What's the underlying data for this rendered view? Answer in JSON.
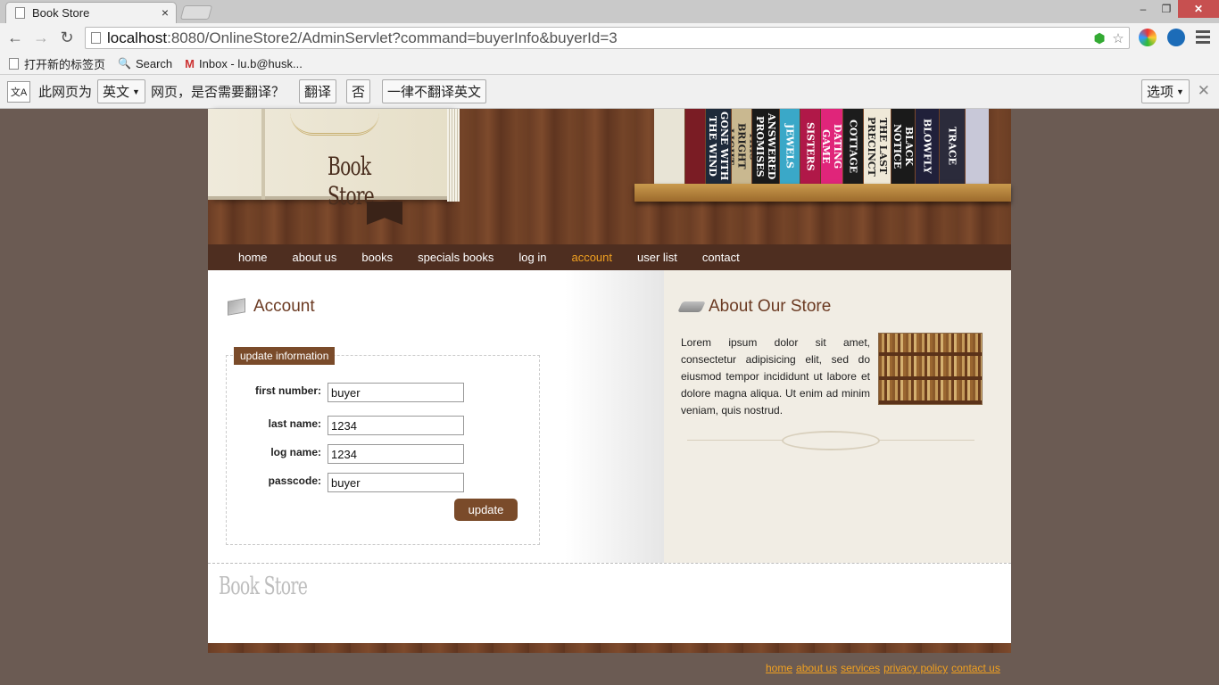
{
  "browser": {
    "tab_title": "Book Store",
    "tab_close": "×",
    "url_host": "localhost",
    "url_rest": ":8080/OnlineStore2/AdminServlet?command=buyerInfo&buyerId=3",
    "bookmarks": [
      {
        "label": "打开新的标签页"
      },
      {
        "label": "Search"
      },
      {
        "label": "Inbox - lu.b@husk..."
      }
    ],
    "window_buttons": {
      "minimize": "–",
      "restore": "❐",
      "close": "✕"
    }
  },
  "translate_bar": {
    "icon": "文A",
    "prefix": "此网页为",
    "language": "英文",
    "suffix": "网页，是否需要翻译？",
    "translate": "翻译",
    "no": "否",
    "never": "一律不翻译英文",
    "options": "选项",
    "close": "✕"
  },
  "header": {
    "logo": "Book Store",
    "shelf_books": [
      "GONE WITH THE WIND",
      "THIS BRIGHT LIGHT",
      "ANSWERED PROMISES",
      "JEWELS",
      "SISTERS",
      "DATING GAME",
      "COTTAGE",
      "THE LAST PRECINCT",
      "BLACK NOTICE",
      "BLOWFLY",
      "TRACE"
    ],
    "shelf_colors": [
      "#e8e4d6",
      "#7a1c24",
      "#1e2a3a",
      "#c9b890",
      "#1a1a1a",
      "#3aa8c8",
      "#b01848",
      "#e0257a",
      "#1c1c1c",
      "#efe9d8",
      "#1a1a1a",
      "#20203a",
      "#2b2b3b",
      "#c8c8d8"
    ]
  },
  "nav": {
    "items": [
      "home",
      "about us",
      "books",
      "specials books",
      "log in",
      "account",
      "user list",
      "contact"
    ],
    "active": "account"
  },
  "account": {
    "title": "Account",
    "legend": "update information",
    "fields": [
      {
        "label": "first number:",
        "value": "buyer"
      },
      {
        "label": "last name:",
        "value": "1234"
      },
      {
        "label": "log name:",
        "value": "1234"
      },
      {
        "label": "passcode:",
        "value": "buyer"
      }
    ],
    "submit": "update"
  },
  "about": {
    "title": "About Our Store",
    "text": "Lorem ipsum dolor sit amet, consectetur adipisicing elit, sed do eiusmod tempor incididunt ut labore et dolore magna aliqua. Ut enim ad minim veniam, quis nostrud."
  },
  "footer": {
    "logo": "Book Store",
    "links": [
      "home",
      "about us",
      "services",
      "privacy policy",
      "contact us"
    ]
  },
  "colors": {
    "accent": "#f0a020",
    "brown": "#7a4b2a",
    "page_bg": "#6b5b53"
  }
}
